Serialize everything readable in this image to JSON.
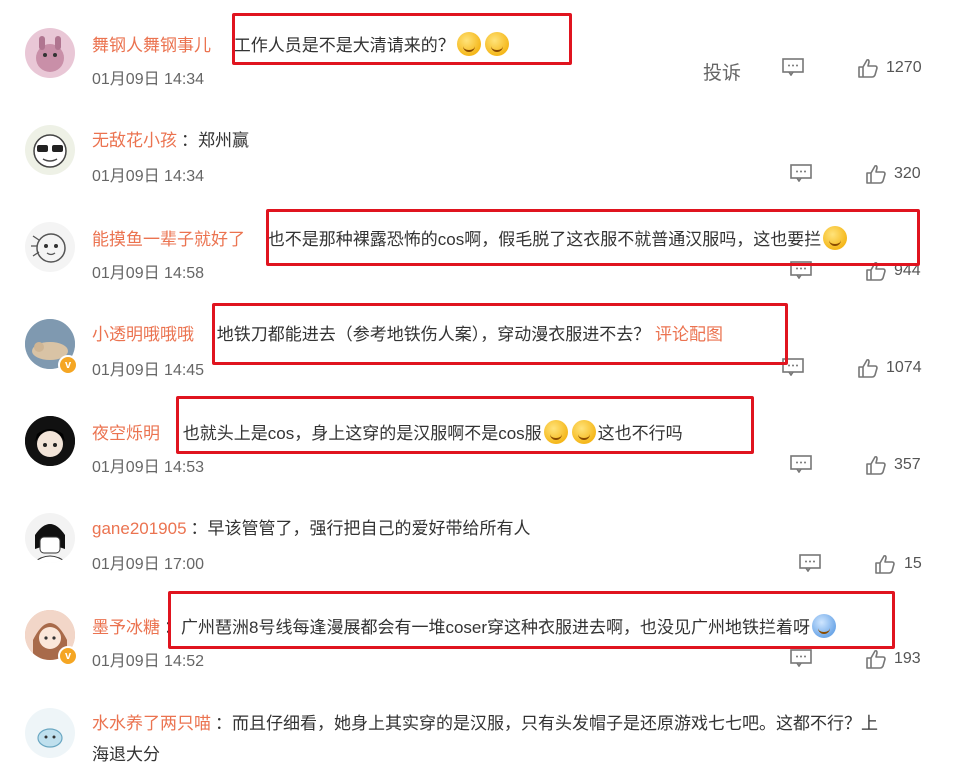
{
  "comments": [
    {
      "user": "舞钢人舞钢事儿",
      "sep": "",
      "text": "工作人员是不是大清请来的？",
      "time": "01月09日 14:34",
      "report": "投诉",
      "likes": "1270",
      "emoji": "yum",
      "avatar_color": "#e9c7d6"
    },
    {
      "user": "无敌花小孩",
      "sep": "：",
      "text": "郑州赢",
      "time": "01月09日 14:34",
      "likes": "320",
      "avatar_color": "#eef1e6"
    },
    {
      "user": "能摸鱼一辈子就好了",
      "sep": "",
      "text": "也不是那种裸露恐怖的cos啊，假毛脱了这衣服不就普通汉服吗，这也要拦",
      "time": "01月09日 14:58",
      "likes": "944",
      "avatar_color": "#f4f4f4"
    },
    {
      "user": "小透明哦哦哦",
      "sep": "",
      "text": "地铁刀都能进去（参考地铁伤人案），穿动漫衣服进不去？",
      "link": "评论配图",
      "time": "01月09日 14:45",
      "likes": "1074",
      "avatar_color": "#9fb6c9"
    },
    {
      "user": "夜空烁明",
      "sep": "",
      "text": "也就头上是cos，身上这穿的是汉服啊不是cos服",
      "text2": "这也不行吗",
      "time": "01月09日 14:53",
      "likes": "357",
      "avatar_color": "#222222"
    },
    {
      "user": "gane201905",
      "sep": "：",
      "text": "早该管管了，强行把自己的爱好带给所有人",
      "time": "01月09日 17:00",
      "likes": "15",
      "avatar_color": "#f3f3f3"
    },
    {
      "user": "墨予冰糖",
      "sep": "：",
      "text": "广州琶洲8号线每逢漫展都会有一堆coser穿这种衣服进去啊，也没见广州地铁拦着呀",
      "time": "01月09日 14:52",
      "likes": "193",
      "avatar_color": "#e9b9a4"
    },
    {
      "user": "水水养了两只喵",
      "sep": "：",
      "text": "而且仔细看，她身上其实穿的是汉服，只有头发帽子是还原游戏七七吧。这都不行？上",
      "text2": "海退大分",
      "avatar_color": "#eef5f8"
    }
  ],
  "colors": {
    "username": "#eb7350",
    "highlight": "#e0141f",
    "verified": "#f5a623"
  }
}
